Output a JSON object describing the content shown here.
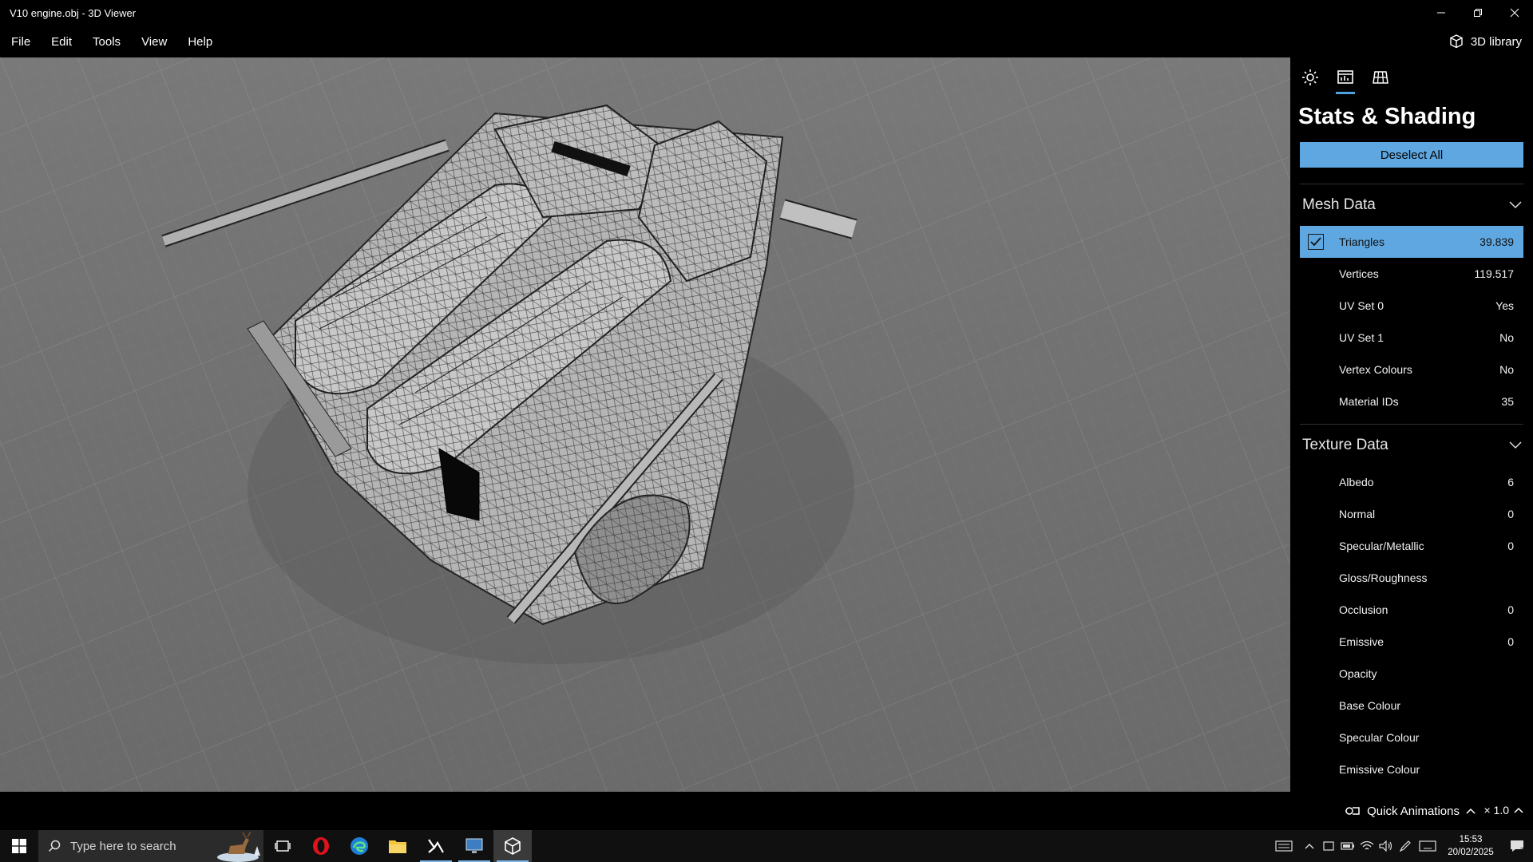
{
  "window": {
    "title": "V10 engine.obj - 3D Viewer"
  },
  "menu": {
    "items": [
      "File",
      "Edit",
      "Tools",
      "View",
      "Help"
    ],
    "library_label": "3D library"
  },
  "panel": {
    "title": "Stats & Shading",
    "deselect_label": "Deselect All",
    "mesh_section": {
      "label": "Mesh Data",
      "rows": [
        {
          "label": "Triangles",
          "value": "39.839",
          "checked": true
        },
        {
          "label": "Vertices",
          "value": "119.517"
        },
        {
          "label": "UV Set 0",
          "value": "Yes"
        },
        {
          "label": "UV Set 1",
          "value": "No"
        },
        {
          "label": "Vertex Colours",
          "value": "No"
        },
        {
          "label": "Material IDs",
          "value": "35"
        }
      ]
    },
    "texture_section": {
      "label": "Texture Data",
      "rows": [
        {
          "label": "Albedo",
          "value": "6"
        },
        {
          "label": "Normal",
          "value": "0"
        },
        {
          "label": "Specular/Metallic",
          "value": "0"
        },
        {
          "label": "Gloss/Roughness",
          "value": ""
        },
        {
          "label": "Occlusion",
          "value": "0"
        },
        {
          "label": "Emissive",
          "value": "0"
        },
        {
          "label": "Opacity",
          "value": ""
        },
        {
          "label": "Base Colour",
          "value": ""
        },
        {
          "label": "Specular Colour",
          "value": ""
        },
        {
          "label": "Emissive Colour",
          "value": ""
        }
      ]
    }
  },
  "status": {
    "quick_animations_label": "Quick Animations",
    "speed_label": "× 1.0"
  },
  "taskbar": {
    "search_placeholder": "Type here to search",
    "time": "15:53",
    "date": "20/02/2025"
  },
  "colors": {
    "accent": "#5fa7e0",
    "viewport_bg": "#6f6f6f"
  }
}
